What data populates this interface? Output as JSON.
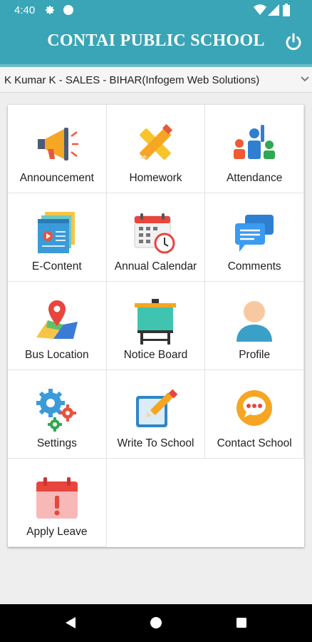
{
  "status_bar": {
    "time": "4:40"
  },
  "app_bar": {
    "title": "CONTAI PUBLIC SCHOOL"
  },
  "profile_selector": {
    "value": "K Kumar K - SALES - BIHAR(Infogem Web Solutions)"
  },
  "menu": {
    "items": [
      {
        "label": "Announcement",
        "icon": "megaphone-icon"
      },
      {
        "label": "Homework",
        "icon": "pencil-ruler-icon"
      },
      {
        "label": "Attendance",
        "icon": "people-hand-raise-icon"
      },
      {
        "label": "E-Content",
        "icon": "video-pages-icon"
      },
      {
        "label": "Annual Calendar",
        "icon": "calendar-clock-icon"
      },
      {
        "label": "Comments",
        "icon": "chat-bubbles-icon"
      },
      {
        "label": "Bus Location",
        "icon": "map-pin-icon"
      },
      {
        "label": "Notice Board",
        "icon": "easel-board-icon"
      },
      {
        "label": "Profile",
        "icon": "user-icon"
      },
      {
        "label": "Settings",
        "icon": "gears-icon"
      },
      {
        "label": "Write To School",
        "icon": "edit-note-icon"
      },
      {
        "label": "Contact School",
        "icon": "chat-bubble-icon"
      },
      {
        "label": "Apply Leave",
        "icon": "calendar-alert-icon"
      }
    ]
  },
  "colors": {
    "primary": "#3aa5b6",
    "background": "#eeeeee"
  }
}
